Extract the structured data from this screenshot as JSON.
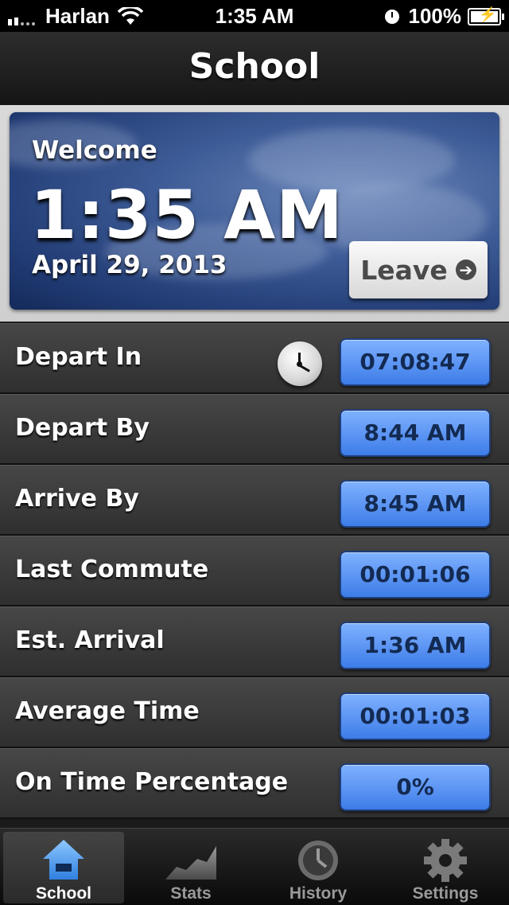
{
  "status_bar": {
    "carrier": "Harlan",
    "time": "1:35 AM",
    "battery": "100%"
  },
  "nav": {
    "title": "School"
  },
  "header": {
    "welcome": "Welcome",
    "time": "1:35 AM",
    "date": "April 29, 2013",
    "leave_label": "Leave"
  },
  "rows": [
    {
      "label": "Depart In",
      "value": "07:08:47"
    },
    {
      "label": "Depart By",
      "value": "8:44 AM"
    },
    {
      "label": "Arrive By",
      "value": "8:45 AM"
    },
    {
      "label": "Last Commute",
      "value": "00:01:06"
    },
    {
      "label": "Est. Arrival",
      "value": "1:36 AM"
    },
    {
      "label": "Average Time",
      "value": "00:01:03"
    },
    {
      "label": "On Time Percentage",
      "value": "0%"
    }
  ],
  "tabs": [
    {
      "label": "School",
      "icon": "home-icon",
      "active": true
    },
    {
      "label": "Stats",
      "icon": "chart-icon",
      "active": false
    },
    {
      "label": "History",
      "icon": "clock-icon",
      "active": false
    },
    {
      "label": "Settings",
      "icon": "gear-icon",
      "active": false
    }
  ],
  "colors": {
    "accent_blue": "#4f8cf0",
    "value_text": "#132a52"
  }
}
